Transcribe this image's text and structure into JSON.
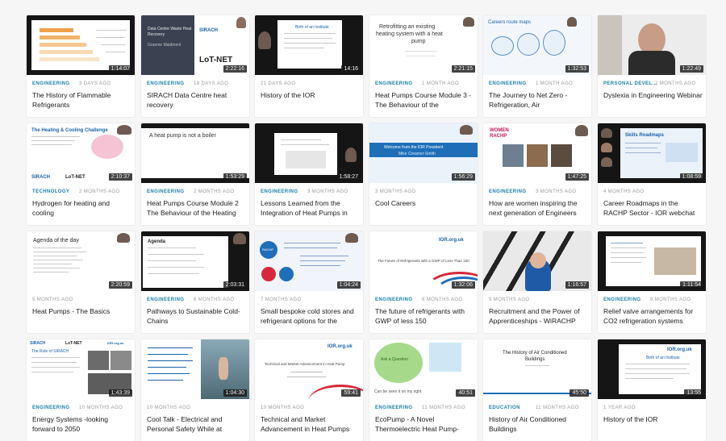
{
  "videos": [
    {
      "category": "ENGINEERING",
      "age": "3 DAYS AGO",
      "title": "The History of Flammable Refrigerants",
      "duration": "1:14:07"
    },
    {
      "category": "ENGINEERING",
      "age": "18 DAYS AGO",
      "title": "SIRACH Data Centre heat recovery",
      "duration": "2:22:16",
      "thumb_text": [
        "Data Centre Waste Heat",
        "Recovery",
        "Graeme Maidment"
      ],
      "logos": [
        "SIRACH",
        "LoT-NET"
      ]
    },
    {
      "category": "",
      "age": "21 DAYS AGO",
      "title": "History of the IOR",
      "duration": "14:16"
    },
    {
      "category": "ENGINEERING",
      "age": "1 MONTH AGO",
      "title": "Heat Pumps Course Module 3 -The Behaviour of the",
      "duration": "2:21:15",
      "thumb_text": [
        "Retrofitting an existing",
        "heating system with a heat",
        "pump"
      ]
    },
    {
      "category": "ENGINEERING",
      "age": "1 MONTH AGO",
      "title": "The Journey to Net Zero - Refrigeration, Air",
      "duration": "1:32:53",
      "thumb_text": [
        "Careers route maps"
      ]
    },
    {
      "category": "PERSONAL DEVEL...",
      "age": "2 MONTHS AGO",
      "title": "Dyslexia in Engineering Webinar",
      "duration": "1:22:49"
    },
    {
      "category": "TECHNOLOGY",
      "age": "2 MONTHS AGO",
      "title": "Hydrogen for heating and cooling",
      "duration": "2:10:37",
      "thumb_text": [
        "The Heating & Cooling Challenge"
      ],
      "logos": [
        "SIRACH",
        "LoT-NET"
      ]
    },
    {
      "category": "ENGINEERING",
      "age": "2 MONTHS AGO",
      "title": "Heat Pumps Course Module 2 The Behaviour of the Heating",
      "duration": "1:53:29",
      "thumb_text": [
        "A heat pump is not a boiler"
      ]
    },
    {
      "category": "ENGINEERING",
      "age": "3 MONTHS AGO",
      "title": "Lessons Learned from the Integration of Heat Pumps in",
      "duration": "1:58:27"
    },
    {
      "category": "",
      "age": "3 MONTHS AGO",
      "title": "Cool Careers",
      "duration": "1:56:29",
      "thumb_text": [
        "Welcome from the IOR President",
        "Mike Creamer-Smith"
      ]
    },
    {
      "category": "ENGINEERING",
      "age": "3 MONTHS AGO",
      "title": "How are women inspiring the next generation of Engineers",
      "duration": "1:47:25",
      "thumb_text": [
        "WOMEN",
        "RACHP"
      ]
    },
    {
      "category": "",
      "age": "4 MONTHS AGO",
      "title": "Career Roadmaps in the RACHP Sector - IOR webchat",
      "duration": "1:08:59",
      "thumb_text": [
        "Skills Roadmaps"
      ]
    },
    {
      "category": "",
      "age": "5 MONTHS AGO",
      "title": "Heat Pumps - The Basics",
      "duration": "2:20:59",
      "thumb_text": [
        "Agenda of the day"
      ]
    },
    {
      "category": "ENGINEERING",
      "age": "6 MONTHS AGO",
      "title": "Pathways to Sustainable Cold-Chains",
      "duration": "2:03:31",
      "thumb_text": [
        "Agenda"
      ]
    },
    {
      "category": "",
      "age": "7 MONTHS AGO",
      "title": "Small bespoke cold stores and refrigerant options for the",
      "duration": "1:04:24",
      "thumb_text": [
        "RACHP"
      ]
    },
    {
      "category": "ENGINEERING",
      "age": "8 MONTHS AGO",
      "title": "The future of refrigerants with GWP of less 150",
      "duration": "1:32:06",
      "thumb_text": [
        "The Future of Refrigerants with a GWP of Less Than 150"
      ],
      "logos": [
        "IOR.org.uk"
      ]
    },
    {
      "category": "",
      "age": "9 MONTHS AGO",
      "title": "Recruitment and the Power of Apprenticeships - WiRACHP",
      "duration": "1:16:57"
    },
    {
      "category": "ENGINEERING",
      "age": "9 MONTHS AGO",
      "title": "Relief valve arrangements for CO2 refrigeration systems",
      "duration": "1:11:54"
    },
    {
      "category": "ENGINEERING",
      "age": "10 MONTHS AGO",
      "title": "Energy Systems -looking forward to 2050",
      "duration": "1:43:39",
      "thumb_text": [
        "The Role of SIRACH"
      ],
      "logos": [
        "SIRACH",
        "LoT-NET",
        "IOR.org.uk"
      ]
    },
    {
      "category": "",
      "age": "10 MONTHS AGO",
      "title": "Cool Talk - Electrical and Personal Safety While at",
      "duration": "1:04:30"
    },
    {
      "category": "",
      "age": "10 MONTHS AGO",
      "title": "Technical and Market Advancement in Heat Pumps",
      "duration": "59:41",
      "thumb_text": [
        "Technical and Market Advancement in Heat Pump"
      ],
      "logos": [
        "IOR.org.uk"
      ]
    },
    {
      "category": "ENGINEERING",
      "age": "11 MONTHS AGO",
      "title": "EcoPump - A Novel Thermoelectric Heat Pump-",
      "duration": "40:51",
      "thumb_text": [
        "Can be seen it on my right"
      ]
    },
    {
      "category": "EDUCATION",
      "age": "11 MONTHS AGO",
      "title": "History of Air Conditioned Buildings",
      "duration": "45:50",
      "thumb_text": [
        "The History of Air Conditioned",
        "Buildings"
      ]
    },
    {
      "category": "",
      "age": "1 YEAR AGO",
      "title": "History of the IOR",
      "duration": "13:55",
      "logos": [
        "IOR.org.uk"
      ]
    }
  ],
  "colors": {
    "category": "#1a7fa8",
    "age": "#9a9a9a",
    "title": "#1c1c1c",
    "background": "#f6f6f6"
  }
}
